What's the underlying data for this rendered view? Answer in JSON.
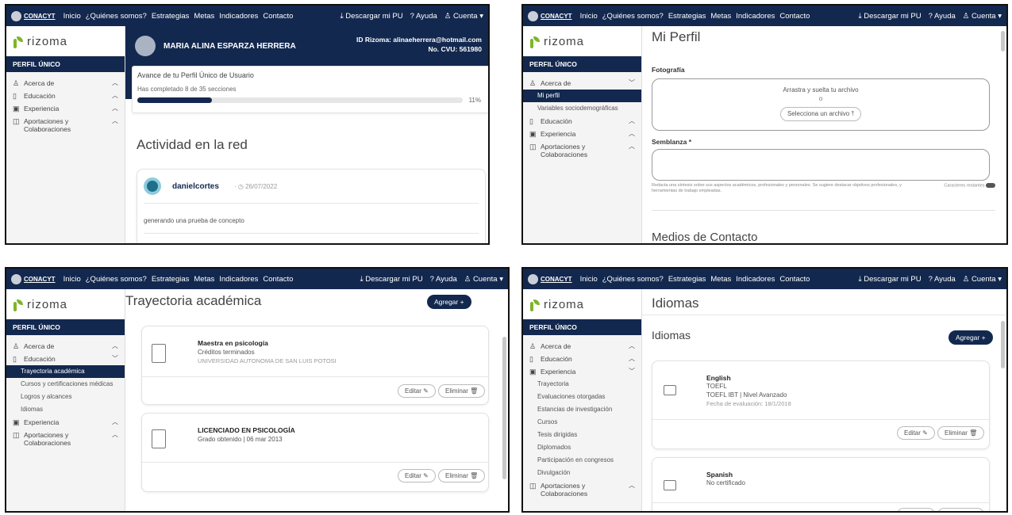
{
  "nav": {
    "brand": "CONACYT",
    "links": [
      "Inicio",
      "¿Quiénes somos?",
      "Estrategias",
      "Metas",
      "Indicadores",
      "Contacto"
    ],
    "download": "Descargar mi PU",
    "help": "Ayuda",
    "account": "Cuenta"
  },
  "sidebar": {
    "logo": "rizoma",
    "section": "PERFIL ÚNICO",
    "acerca": "Acerca de",
    "mi_perfil": "Mi perfil",
    "variables": "Variables sociodemográficas",
    "educacion": "Educación",
    "experiencia": "Experiencia",
    "aportaciones": "Aportaciones y Colaboraciones",
    "edu_subs": [
      "Trayectoria académica",
      "Cursos y certificaciones médicas",
      "Logros y alcances",
      "Idiomas"
    ],
    "exp_subs": [
      "Trayectoria",
      "Evaluaciones otorgadas",
      "Estancias de investigación",
      "Cursos",
      "Tesis dirigidas",
      "Diplomados",
      "Participación en congresos",
      "Divulgación"
    ]
  },
  "p1": {
    "user_name": "MARIA ALINA ESPARZA HERRERA",
    "rizoma_id": "ID Rizoma: alinaeherrera@hotmail.com",
    "cvu": "No. CVU: 561980",
    "progress_title": "Avance de tu Perfil Único de Usuario",
    "progress_text": "Has completado 8 de 35 secciones",
    "progress_pct": "11%",
    "progress_fraction": 0.23,
    "activity_title": "Actividad en la red",
    "post_user": "danielcortes",
    "post_date": "26/07/2022",
    "post_text": "generando una prueba de concepto"
  },
  "p2": {
    "title": "Mi Perfil",
    "foto_label": "Fotografía",
    "drop_text": "Arrastra y suelta tu archivo",
    "or_text": "o",
    "select_btn": "Selecciona un archivo",
    "semblanza_label": "Semblanza *",
    "help_text": "Redacta una síntesis sobre sus aspectos académicos, profesionales y personales. Se sugiere destacar objetivos profesionales, y herramientas de trabajo empleadas.",
    "chars_label": "Caracteres restantes",
    "contact_title": "Medios de Contacto"
  },
  "p3": {
    "title": "Trayectoria académica",
    "add_btn": "Agregar +",
    "cards": [
      {
        "degree": "Maestra en psicología",
        "status": "Créditos terminados",
        "school": "UNIVERSIDAD AUTONOMA DE SAN LUIS POTOSI"
      },
      {
        "degree": "LICENCIADO EN PSICOLOGÍA",
        "status": "Grado obtenido | 06 mar 2013",
        "school": ""
      }
    ],
    "edit": "Editar",
    "delete": "Eliminar"
  },
  "p4": {
    "title": "Idiomas",
    "subtitle": "Idiomas",
    "add_btn": "Agregar +",
    "cards": [
      {
        "lang": "English",
        "cert": "TOEFL",
        "level": "TOEFL IBT | Nivel Avanzado",
        "date": "Fecha de evaluación: 18/1/2018"
      },
      {
        "lang": "Spanish",
        "cert": "No certificado",
        "level": "",
        "date": ""
      }
    ],
    "edit": "Editar",
    "delete": "Eliminar"
  },
  "colors": {
    "navy": "#13284f",
    "green": "#7db529"
  }
}
